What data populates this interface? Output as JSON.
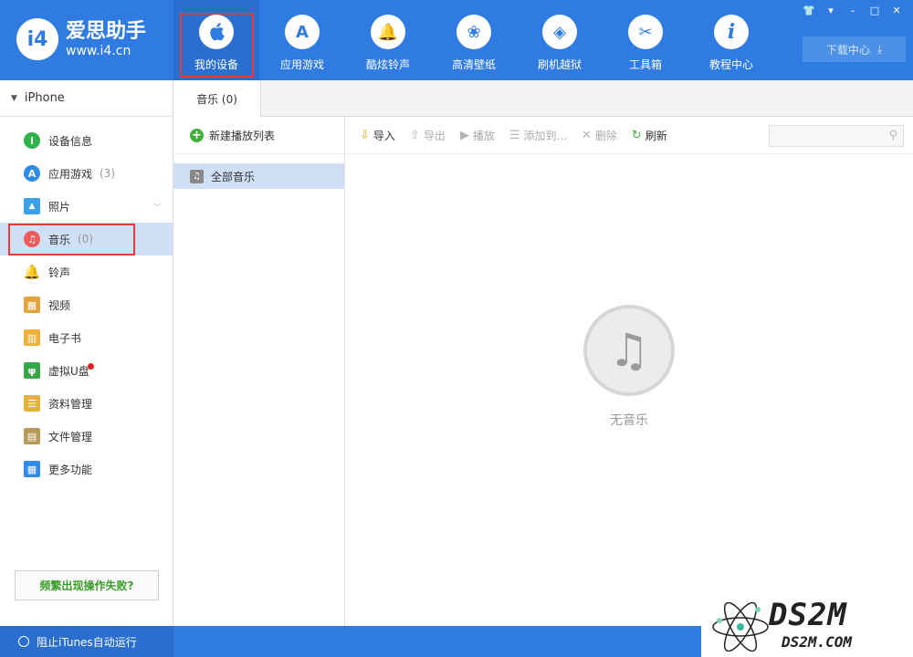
{
  "app": {
    "logo_badge": "i4",
    "name": "爱思助手",
    "url": "www.i4.cn"
  },
  "nav": [
    {
      "label": "我的设备",
      "icon": "apple-icon",
      "glyph": ""
    },
    {
      "label": "应用游戏",
      "icon": "app-store-icon",
      "glyph": "A"
    },
    {
      "label": "酷炫铃声",
      "icon": "bell-icon",
      "glyph": "🔔"
    },
    {
      "label": "高清壁纸",
      "icon": "flower-icon",
      "glyph": "❀"
    },
    {
      "label": "刷机越狱",
      "icon": "dropbox-icon",
      "glyph": "◈"
    },
    {
      "label": "工具箱",
      "icon": "tools-icon",
      "glyph": "✂"
    },
    {
      "label": "教程中心",
      "icon": "info-icon",
      "glyph": "i"
    }
  ],
  "window_controls": [
    "👕",
    "▾",
    "–",
    "□",
    "✕"
  ],
  "download": {
    "label": "下载中心",
    "icon": "⤓"
  },
  "sidebar": {
    "device": "iPhone",
    "items": [
      {
        "label": "设备信息",
        "count": "",
        "icon": "info-icon",
        "glyph": "i",
        "color": "#2fb24a"
      },
      {
        "label": "应用游戏",
        "count": "(3)",
        "icon": "app-store-icon",
        "glyph": "A",
        "color": "#2f8be6"
      },
      {
        "label": "照片",
        "count": "",
        "icon": "photo-icon",
        "glyph": "▲",
        "color": "#3aa0e8"
      },
      {
        "label": "音乐",
        "count": "(0)",
        "icon": "music-icon",
        "glyph": "♫",
        "color": "#ef5a5a"
      },
      {
        "label": "铃声",
        "count": "",
        "icon": "bell-icon",
        "glyph": "🔔",
        "color": "#2f8be6"
      },
      {
        "label": "视频",
        "count": "",
        "icon": "film-icon",
        "glyph": "▦",
        "color": "#e3a33a"
      },
      {
        "label": "电子书",
        "count": "",
        "icon": "book-icon",
        "glyph": "▥",
        "color": "#f0b13a"
      },
      {
        "label": "虚拟U盘",
        "count": "",
        "icon": "usb-icon",
        "glyph": "ψ",
        "color": "#3aa64a"
      },
      {
        "label": "资料管理",
        "count": "",
        "icon": "contacts-icon",
        "glyph": "☰",
        "color": "#e3b23a"
      },
      {
        "label": "文件管理",
        "count": "",
        "icon": "file-icon",
        "glyph": "▤",
        "color": "#b59a5a"
      },
      {
        "label": "更多功能",
        "count": "",
        "icon": "grid-icon",
        "glyph": "▦",
        "color": "#2f8be6"
      }
    ],
    "help_button": "频繁出现操作失败?"
  },
  "status": {
    "itunes_label": "阻止iTunes自动运行"
  },
  "content": {
    "tab": "音乐 (0)",
    "new_playlist": "新建播放列表",
    "playlist_all": "全部音乐",
    "toolbar": [
      {
        "label": "导入",
        "icon": "import-icon",
        "glyph": "⇩",
        "enabled": true
      },
      {
        "label": "导出",
        "icon": "export-icon",
        "glyph": "⇧",
        "enabled": false
      },
      {
        "label": "播放",
        "icon": "play-icon",
        "glyph": "▶",
        "enabled": false
      },
      {
        "label": "添加到...",
        "icon": "add-to-icon",
        "glyph": "☰",
        "enabled": false
      },
      {
        "label": "删除",
        "icon": "delete-icon",
        "glyph": "✕",
        "enabled": false
      },
      {
        "label": "刷新",
        "icon": "refresh-icon",
        "glyph": "↻",
        "enabled": true
      }
    ],
    "empty_text": "无音乐"
  },
  "watermark": {
    "big": "DS2M",
    "small": "DS2M.COM"
  },
  "colors": {
    "primary": "#2f7be1",
    "highlight": "#e23c3c",
    "selected": "#cfdff5"
  }
}
